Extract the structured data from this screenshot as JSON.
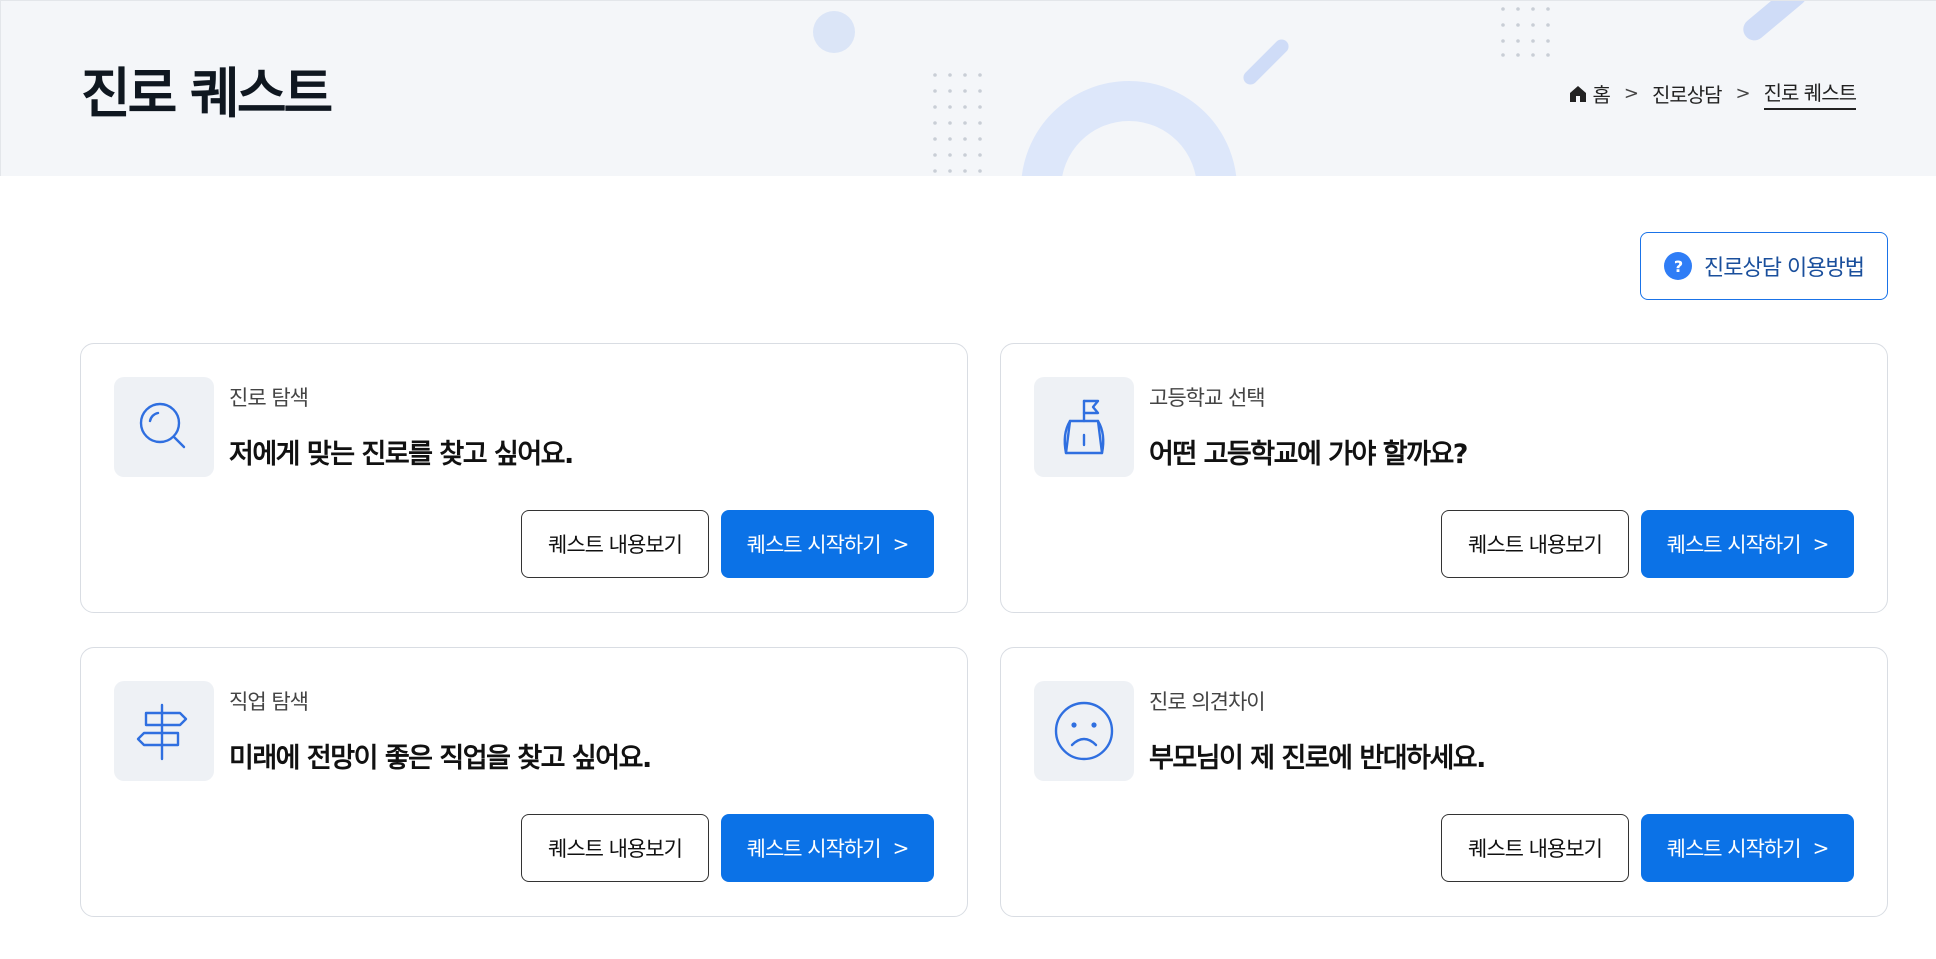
{
  "header": {
    "title": "진로 퀘스트",
    "breadcrumb": {
      "home": "홈",
      "items": [
        "진로상담",
        "진로 퀘스트"
      ]
    }
  },
  "help_button": {
    "label": "진로상담 이용방법",
    "icon": "?"
  },
  "colors": {
    "accent": "#0b72e7",
    "icon_stroke": "#2f6fe0",
    "band": "#f4f6f9"
  },
  "cards": [
    {
      "icon": "magnifier-icon",
      "category": "진로 탐색",
      "headline": "저에게 맞는 진로를 찾고 싶어요.",
      "view_label": "퀘스트 내용보기",
      "start_label": "퀘스트 시작하기"
    },
    {
      "icon": "flag-school-icon",
      "category": "고등학교 선택",
      "headline": "어떤 고등학교에 가야 할까요?",
      "view_label": "퀘스트 내용보기",
      "start_label": "퀘스트 시작하기"
    },
    {
      "icon": "signpost-icon",
      "category": "직업 탐색",
      "headline": "미래에 전망이 좋은 직업을 찾고 싶어요.",
      "view_label": "퀘스트 내용보기",
      "start_label": "퀘스트 시작하기"
    },
    {
      "icon": "sad-face-icon",
      "category": "진로 의견차이",
      "headline": "부모님이 제 진로에 반대하세요.",
      "view_label": "퀘스트 내용보기",
      "start_label": "퀘스트 시작하기"
    }
  ]
}
